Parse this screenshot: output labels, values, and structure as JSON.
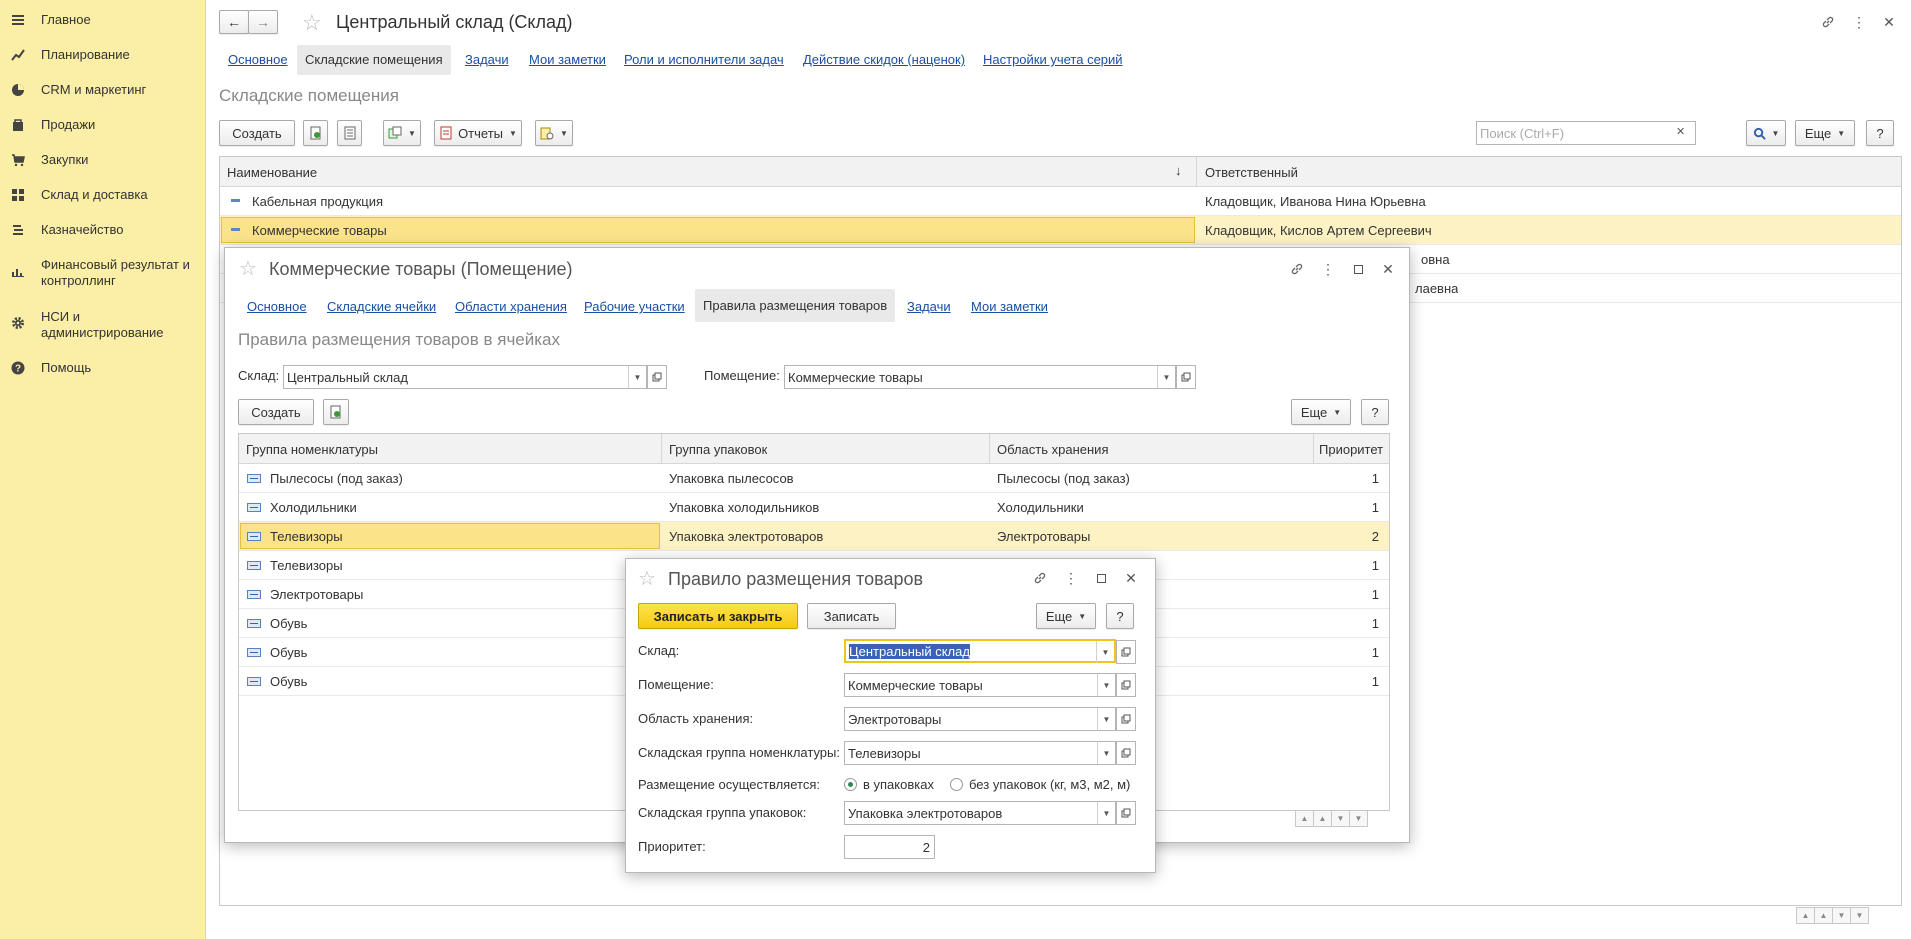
{
  "sidebar": {
    "items": [
      {
        "label": "Главное",
        "icon": "menu-icon"
      },
      {
        "label": "Планирование",
        "icon": "planning-icon"
      },
      {
        "label": "CRM и маркетинг",
        "icon": "crm-icon"
      },
      {
        "label": "Продажи",
        "icon": "bag-icon"
      },
      {
        "label": "Закупки",
        "icon": "cart-icon"
      },
      {
        "label": "Склад и доставка",
        "icon": "warehouse-icon"
      },
      {
        "label": "Казначейство",
        "icon": "treasury-icon"
      },
      {
        "label": "Финансовый результат и контроллинг",
        "icon": "chart-icon"
      },
      {
        "label": "НСИ и администрирование",
        "icon": "gear-icon"
      },
      {
        "label": "Помощь",
        "icon": "help-icon"
      }
    ]
  },
  "main": {
    "title": "Центральный склад (Склад)",
    "tabs": [
      "Основное",
      "Складские помещения",
      "Задачи",
      "Мои заметки",
      "Роли и исполнители задач",
      "Действие скидок (наценок)",
      "Настройки учета серий"
    ],
    "active_tab": "Складские помещения",
    "section_title": "Складские помещения",
    "toolbar": {
      "create": "Создать",
      "reports": "Отчеты",
      "search_placeholder": "Поиск (Ctrl+F)",
      "more": "Еще",
      "help": "?"
    },
    "grid": {
      "headers": [
        "Наименование",
        "Ответственный"
      ],
      "sort_marker": "↓",
      "rows": [
        {
          "name": "Кабельная продукция",
          "responsible": "Кладовщик, Иванова Нина Юрьевна"
        },
        {
          "name": "Коммерческие товары",
          "responsible": "Кладовщик, Кислов Артем Сергеевич"
        },
        {
          "name": "",
          "responsible": "овна"
        },
        {
          "name": "",
          "responsible": "лаевна"
        }
      ]
    }
  },
  "room_window": {
    "title": "Коммерческие товары (Помещение)",
    "tabs": [
      "Основное",
      "Складские ячейки",
      "Области хранения",
      "Рабочие участки",
      "Правила размещения товаров",
      "Задачи",
      "Мои заметки"
    ],
    "active_tab": "Правила размещения товаров",
    "section_title": "Правила размещения товаров в ячейках",
    "warehouse_label": "Склад:",
    "warehouse_value": "Центральный склад",
    "room_label": "Помещение:",
    "room_value": "Коммерческие товары",
    "create": "Создать",
    "more": "Еще",
    "help": "?",
    "grid": {
      "headers": [
        "Группа номенклатуры",
        "Группа упаковок",
        "Область хранения",
        "Приоритет"
      ],
      "rows": [
        {
          "group": "Пылесосы (под заказ)",
          "pack": "Упаковка пылесосов",
          "area": "Пылесосы (под заказ)",
          "priority": "1"
        },
        {
          "group": "Холодильники",
          "pack": "Упаковка холодильников",
          "area": "Холодильники",
          "priority": "1"
        },
        {
          "group": "Телевизоры",
          "pack": "Упаковка электротоваров",
          "area": "Электротовары",
          "priority": "2"
        },
        {
          "group": "Телевизоры",
          "pack": "",
          "area": "",
          "priority": "1"
        },
        {
          "group": "Электротовары",
          "pack": "",
          "area": "",
          "priority": "1"
        },
        {
          "group": "Обувь",
          "pack": "",
          "area": "",
          "priority": "1"
        },
        {
          "group": "Обувь",
          "pack": "",
          "area": "",
          "priority": "1"
        },
        {
          "group": "Обувь",
          "pack": "",
          "area": "",
          "priority": "1"
        }
      ]
    }
  },
  "rule_dialog": {
    "title": "Правило размещения товаров",
    "save_close": "Записать и закрыть",
    "save": "Записать",
    "more": "Еще",
    "help": "?",
    "fields": {
      "warehouse_label": "Склад:",
      "warehouse_value": "Центральный склад",
      "room_label": "Помещение:",
      "room_value": "Коммерческие товары",
      "area_label": "Область хранения:",
      "area_value": "Электротовары",
      "group_label": "Складская группа номенклатуры:",
      "group_value": "Телевизоры",
      "placement_label": "Размещение осуществляется:",
      "option_packages": "в упаковках",
      "option_units": "без упаковок (кг, м3, м2, м)",
      "placement_selected": "в упаковках",
      "pack_group_label": "Складская группа упаковок:",
      "pack_group_value": "Упаковка электротоваров",
      "priority_label": "Приоритет:",
      "priority_value": "2"
    }
  },
  "colors": {
    "sidebar_bg": "#fbeea6",
    "link": "#1a4fa0",
    "selected_row": "#fdf2c4",
    "primary_button": "#f5cc14"
  }
}
